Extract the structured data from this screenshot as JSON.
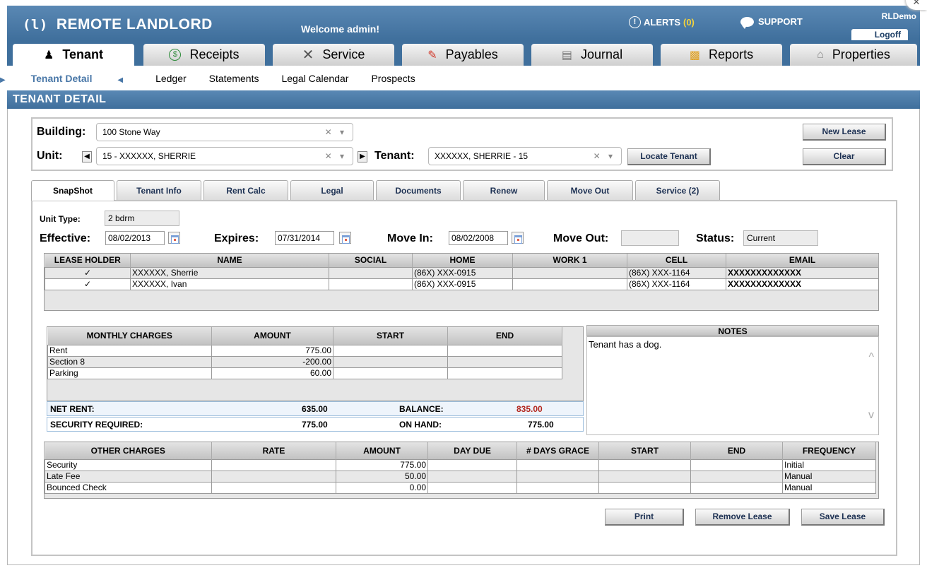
{
  "header": {
    "app_name": "REMOTE LANDLORD",
    "welcome": "Welcome admin!",
    "alerts_label": "ALERTS",
    "alerts_count": "(0)",
    "support_label": "SUPPORT",
    "username": "RLDemo",
    "logoff": "Logoff"
  },
  "main_tabs": [
    {
      "label": "Tenant",
      "icon": "person-icon"
    },
    {
      "label": "Receipts",
      "icon": "dollar-icon"
    },
    {
      "label": "Service",
      "icon": "tools-icon"
    },
    {
      "label": "Payables",
      "icon": "pen-icon"
    },
    {
      "label": "Journal",
      "icon": "graph-icon"
    },
    {
      "label": "Reports",
      "icon": "bar-chart-icon"
    },
    {
      "label": "Properties",
      "icon": "house-icon"
    }
  ],
  "sub_nav": {
    "active": "Tenant Detail",
    "items": [
      "Ledger",
      "Statements",
      "Legal Calendar",
      "Prospects"
    ]
  },
  "section_title": "TENANT DETAIL",
  "selection": {
    "building_label": "Building:",
    "building_value": "100 Stone Way",
    "unit_label": "Unit:",
    "unit_value": "15 - XXXXXX, SHERRIE",
    "tenant_label": "Tenant:",
    "tenant_value": "XXXXXX, SHERRIE - 15",
    "locate_tenant": "Locate Tenant",
    "new_lease": "New Lease",
    "clear": "Clear"
  },
  "detail_tabs": [
    "SnapShot",
    "Tenant Info",
    "Rent Calc",
    "Legal",
    "Documents",
    "Renew",
    "Move Out",
    "Service (2)"
  ],
  "lease": {
    "unit_type_label": "Unit Type:",
    "unit_type": "2 bdrm",
    "effective_label": "Effective:",
    "effective": "08/02/2013",
    "expires_label": "Expires:",
    "expires": "07/31/2014",
    "move_in_label": "Move In:",
    "move_in": "08/02/2008",
    "move_out_label": "Move Out:",
    "move_out": "",
    "status_label": "Status:",
    "status": "Current"
  },
  "holders": {
    "columns": [
      "LEASE HOLDER",
      "NAME",
      "SOCIAL",
      "HOME",
      "WORK 1",
      "CELL",
      "EMAIL"
    ],
    "rows": [
      [
        "✓",
        "XXXXXX, Sherrie",
        "",
        "(86X) XXX-0915",
        "",
        "(86X) XXX-1164",
        "XXXXXXXXXXXXX"
      ],
      [
        "✓",
        "XXXXXX, Ivan",
        "",
        "(86X) XXX-0915",
        "",
        "(86X) XXX-1164",
        "XXXXXXXXXXXXX"
      ]
    ]
  },
  "monthly": {
    "columns": [
      "MONTHLY CHARGES",
      "AMOUNT",
      "START",
      "END"
    ],
    "rows": [
      [
        "Rent",
        "775.00",
        "",
        ""
      ],
      [
        "Section 8",
        "-200.00",
        "",
        ""
      ],
      [
        "Parking",
        "60.00",
        "",
        ""
      ]
    ],
    "net_rent_label": "NET RENT:",
    "net_rent": "635.00",
    "balance_label": "BALANCE:",
    "balance": "835.00",
    "security_label": "SECURITY REQUIRED:",
    "security": "775.00",
    "on_hand_label": "ON HAND:",
    "on_hand": "775.00",
    "balance_color": "#b3261e"
  },
  "notes": {
    "title": "NOTES",
    "text": "Tenant has a dog."
  },
  "other": {
    "columns": [
      "OTHER CHARGES",
      "RATE",
      "AMOUNT",
      "DAY DUE",
      "# DAYS GRACE",
      "START",
      "END",
      "FREQUENCY"
    ],
    "rows": [
      [
        "Security",
        "",
        "775.00",
        "",
        "",
        "",
        "",
        "Initial"
      ],
      [
        "Late Fee",
        "",
        "50.00",
        "",
        "",
        "",
        "",
        "Manual"
      ],
      [
        "Bounced Check",
        "",
        "0.00",
        "",
        "",
        "",
        "",
        "Manual"
      ]
    ]
  },
  "actions": {
    "print": "Print",
    "remove_lease": "Remove Lease",
    "save_lease": "Save Lease"
  },
  "colors": {
    "header_blue": "#4a78a8",
    "accent_link": "#4a78a8",
    "alerts_yellow": "#f5d33a"
  }
}
